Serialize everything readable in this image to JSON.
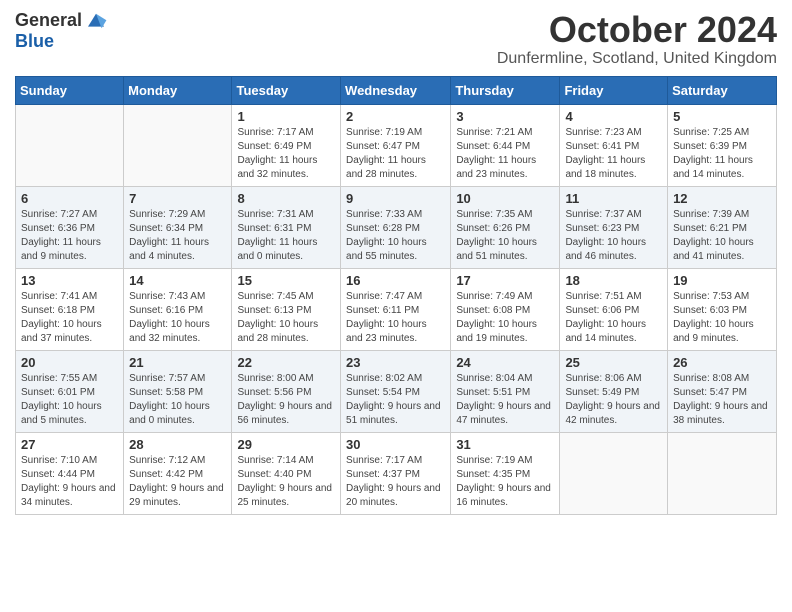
{
  "logo": {
    "general": "General",
    "blue": "Blue"
  },
  "title": "October 2024",
  "location": "Dunfermline, Scotland, United Kingdom",
  "days_header": [
    "Sunday",
    "Monday",
    "Tuesday",
    "Wednesday",
    "Thursday",
    "Friday",
    "Saturday"
  ],
  "weeks": [
    [
      {
        "num": "",
        "detail": ""
      },
      {
        "num": "",
        "detail": ""
      },
      {
        "num": "1",
        "detail": "Sunrise: 7:17 AM\nSunset: 6:49 PM\nDaylight: 11 hours and 32 minutes."
      },
      {
        "num": "2",
        "detail": "Sunrise: 7:19 AM\nSunset: 6:47 PM\nDaylight: 11 hours and 28 minutes."
      },
      {
        "num": "3",
        "detail": "Sunrise: 7:21 AM\nSunset: 6:44 PM\nDaylight: 11 hours and 23 minutes."
      },
      {
        "num": "4",
        "detail": "Sunrise: 7:23 AM\nSunset: 6:41 PM\nDaylight: 11 hours and 18 minutes."
      },
      {
        "num": "5",
        "detail": "Sunrise: 7:25 AM\nSunset: 6:39 PM\nDaylight: 11 hours and 14 minutes."
      }
    ],
    [
      {
        "num": "6",
        "detail": "Sunrise: 7:27 AM\nSunset: 6:36 PM\nDaylight: 11 hours and 9 minutes."
      },
      {
        "num": "7",
        "detail": "Sunrise: 7:29 AM\nSunset: 6:34 PM\nDaylight: 11 hours and 4 minutes."
      },
      {
        "num": "8",
        "detail": "Sunrise: 7:31 AM\nSunset: 6:31 PM\nDaylight: 11 hours and 0 minutes."
      },
      {
        "num": "9",
        "detail": "Sunrise: 7:33 AM\nSunset: 6:28 PM\nDaylight: 10 hours and 55 minutes."
      },
      {
        "num": "10",
        "detail": "Sunrise: 7:35 AM\nSunset: 6:26 PM\nDaylight: 10 hours and 51 minutes."
      },
      {
        "num": "11",
        "detail": "Sunrise: 7:37 AM\nSunset: 6:23 PM\nDaylight: 10 hours and 46 minutes."
      },
      {
        "num": "12",
        "detail": "Sunrise: 7:39 AM\nSunset: 6:21 PM\nDaylight: 10 hours and 41 minutes."
      }
    ],
    [
      {
        "num": "13",
        "detail": "Sunrise: 7:41 AM\nSunset: 6:18 PM\nDaylight: 10 hours and 37 minutes."
      },
      {
        "num": "14",
        "detail": "Sunrise: 7:43 AM\nSunset: 6:16 PM\nDaylight: 10 hours and 32 minutes."
      },
      {
        "num": "15",
        "detail": "Sunrise: 7:45 AM\nSunset: 6:13 PM\nDaylight: 10 hours and 28 minutes."
      },
      {
        "num": "16",
        "detail": "Sunrise: 7:47 AM\nSunset: 6:11 PM\nDaylight: 10 hours and 23 minutes."
      },
      {
        "num": "17",
        "detail": "Sunrise: 7:49 AM\nSunset: 6:08 PM\nDaylight: 10 hours and 19 minutes."
      },
      {
        "num": "18",
        "detail": "Sunrise: 7:51 AM\nSunset: 6:06 PM\nDaylight: 10 hours and 14 minutes."
      },
      {
        "num": "19",
        "detail": "Sunrise: 7:53 AM\nSunset: 6:03 PM\nDaylight: 10 hours and 9 minutes."
      }
    ],
    [
      {
        "num": "20",
        "detail": "Sunrise: 7:55 AM\nSunset: 6:01 PM\nDaylight: 10 hours and 5 minutes."
      },
      {
        "num": "21",
        "detail": "Sunrise: 7:57 AM\nSunset: 5:58 PM\nDaylight: 10 hours and 0 minutes."
      },
      {
        "num": "22",
        "detail": "Sunrise: 8:00 AM\nSunset: 5:56 PM\nDaylight: 9 hours and 56 minutes."
      },
      {
        "num": "23",
        "detail": "Sunrise: 8:02 AM\nSunset: 5:54 PM\nDaylight: 9 hours and 51 minutes."
      },
      {
        "num": "24",
        "detail": "Sunrise: 8:04 AM\nSunset: 5:51 PM\nDaylight: 9 hours and 47 minutes."
      },
      {
        "num": "25",
        "detail": "Sunrise: 8:06 AM\nSunset: 5:49 PM\nDaylight: 9 hours and 42 minutes."
      },
      {
        "num": "26",
        "detail": "Sunrise: 8:08 AM\nSunset: 5:47 PM\nDaylight: 9 hours and 38 minutes."
      }
    ],
    [
      {
        "num": "27",
        "detail": "Sunrise: 7:10 AM\nSunset: 4:44 PM\nDaylight: 9 hours and 34 minutes."
      },
      {
        "num": "28",
        "detail": "Sunrise: 7:12 AM\nSunset: 4:42 PM\nDaylight: 9 hours and 29 minutes."
      },
      {
        "num": "29",
        "detail": "Sunrise: 7:14 AM\nSunset: 4:40 PM\nDaylight: 9 hours and 25 minutes."
      },
      {
        "num": "30",
        "detail": "Sunrise: 7:17 AM\nSunset: 4:37 PM\nDaylight: 9 hours and 20 minutes."
      },
      {
        "num": "31",
        "detail": "Sunrise: 7:19 AM\nSunset: 4:35 PM\nDaylight: 9 hours and 16 minutes."
      },
      {
        "num": "",
        "detail": ""
      },
      {
        "num": "",
        "detail": ""
      }
    ]
  ]
}
